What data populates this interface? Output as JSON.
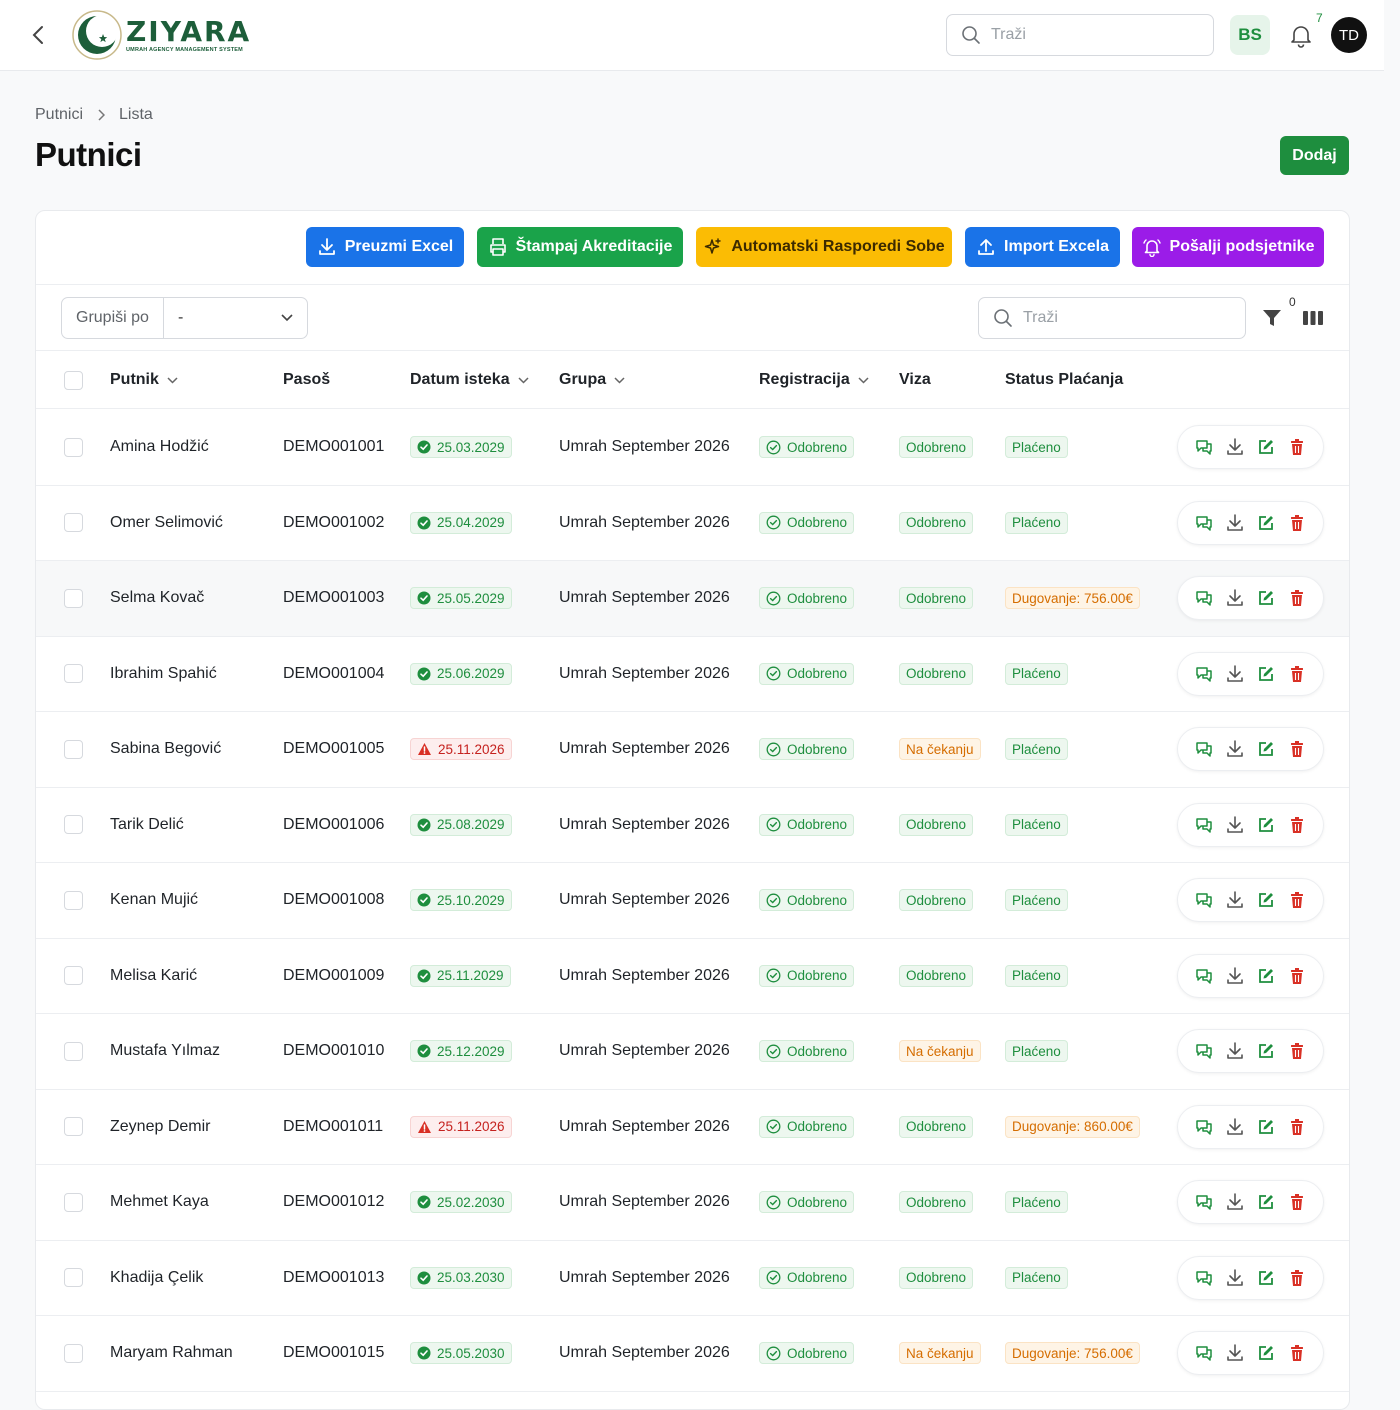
{
  "topbar": {
    "logo_name": "ZIYARA",
    "logo_subtitle": "UMRAH AGENCY MANAGEMENT SYSTEM",
    "search_placeholder": "Traži",
    "lang": "BS",
    "notifications": "7",
    "avatar_initials": "TD"
  },
  "breadcrumb": {
    "items": [
      "Putnici",
      "Lista"
    ]
  },
  "page": {
    "title": "Putnici",
    "add_label": "Dodaj"
  },
  "actions": {
    "excel": "Preuzmi Excel",
    "print": "Štampaj Akreditacije",
    "auto_rooms": "Automatski Rasporedi Sobe",
    "import": "Import Excela",
    "reminders": "Pošalji podsjetnike"
  },
  "filters": {
    "group_by_label": "Grupiši po",
    "group_by_value": "-",
    "search_placeholder": "Traži",
    "filter_count": "0"
  },
  "table": {
    "columns": [
      "Putnik",
      "Pasoš",
      "Datum isteka",
      "Grupa",
      "Registracija",
      "Viza",
      "Status Plaćanja"
    ],
    "rows": [
      {
        "name": "Amina Hodžić",
        "passport": "DEMO001001",
        "expiry": "25.03.2029",
        "expiry_ok": true,
        "group": "Umrah September 2026",
        "registration": "Odobreno",
        "visa": "Odobreno",
        "visa_ok": true,
        "payment": "Plaćeno",
        "paid": true
      },
      {
        "name": "Omer Selimović",
        "passport": "DEMO001002",
        "expiry": "25.04.2029",
        "expiry_ok": true,
        "group": "Umrah September 2026",
        "registration": "Odobreno",
        "visa": "Odobreno",
        "visa_ok": true,
        "payment": "Plaćeno",
        "paid": true
      },
      {
        "name": "Selma Kovač",
        "passport": "DEMO001003",
        "expiry": "25.05.2029",
        "expiry_ok": true,
        "group": "Umrah September 2026",
        "registration": "Odobreno",
        "visa": "Odobreno",
        "visa_ok": true,
        "payment": "Dugovanje: 756.00€",
        "paid": false
      },
      {
        "name": "Ibrahim Spahić",
        "passport": "DEMO001004",
        "expiry": "25.06.2029",
        "expiry_ok": true,
        "group": "Umrah September 2026",
        "registration": "Odobreno",
        "visa": "Odobreno",
        "visa_ok": true,
        "payment": "Plaćeno",
        "paid": true
      },
      {
        "name": "Sabina Begović",
        "passport": "DEMO001005",
        "expiry": "25.11.2026",
        "expiry_ok": false,
        "group": "Umrah September 2026",
        "registration": "Odobreno",
        "visa": "Na čekanju",
        "visa_ok": false,
        "payment": "Plaćeno",
        "paid": true
      },
      {
        "name": "Tarik Delić",
        "passport": "DEMO001006",
        "expiry": "25.08.2029",
        "expiry_ok": true,
        "group": "Umrah September 2026",
        "registration": "Odobreno",
        "visa": "Odobreno",
        "visa_ok": true,
        "payment": "Plaćeno",
        "paid": true
      },
      {
        "name": "Kenan Mujić",
        "passport": "DEMO001008",
        "expiry": "25.10.2029",
        "expiry_ok": true,
        "group": "Umrah September 2026",
        "registration": "Odobreno",
        "visa": "Odobreno",
        "visa_ok": true,
        "payment": "Plaćeno",
        "paid": true
      },
      {
        "name": "Melisa Karić",
        "passport": "DEMO001009",
        "expiry": "25.11.2029",
        "expiry_ok": true,
        "group": "Umrah September 2026",
        "registration": "Odobreno",
        "visa": "Odobreno",
        "visa_ok": true,
        "payment": "Plaćeno",
        "paid": true
      },
      {
        "name": "Mustafa Yılmaz",
        "passport": "DEMO001010",
        "expiry": "25.12.2029",
        "expiry_ok": true,
        "group": "Umrah September 2026",
        "registration": "Odobreno",
        "visa": "Na čekanju",
        "visa_ok": false,
        "payment": "Plaćeno",
        "paid": true
      },
      {
        "name": "Zeynep Demir",
        "passport": "DEMO001011",
        "expiry": "25.11.2026",
        "expiry_ok": false,
        "group": "Umrah September 2026",
        "registration": "Odobreno",
        "visa": "Odobreno",
        "visa_ok": true,
        "payment": "Dugovanje: 860.00€",
        "paid": false
      },
      {
        "name": "Mehmet Kaya",
        "passport": "DEMO001012",
        "expiry": "25.02.2030",
        "expiry_ok": true,
        "group": "Umrah September 2026",
        "registration": "Odobreno",
        "visa": "Odobreno",
        "visa_ok": true,
        "payment": "Plaćeno",
        "paid": true
      },
      {
        "name": "Khadija Çelik",
        "passport": "DEMO001013",
        "expiry": "25.03.2030",
        "expiry_ok": true,
        "group": "Umrah September 2026",
        "registration": "Odobreno",
        "visa": "Odobreno",
        "visa_ok": true,
        "payment": "Plaćeno",
        "paid": true
      },
      {
        "name": "Maryam Rahman",
        "passport": "DEMO001015",
        "expiry": "25.05.2030",
        "expiry_ok": true,
        "group": "Umrah September 2026",
        "registration": "Odobreno",
        "visa": "Na čekanju",
        "visa_ok": false,
        "payment": "Dugovanje: 756.00€",
        "paid": false
      }
    ]
  },
  "colors": {
    "primary": "#1a73e8",
    "success": "#1e8e3e",
    "warning": "#fbbc04",
    "purple": "#9b1ce8",
    "danger": "#d93025"
  }
}
